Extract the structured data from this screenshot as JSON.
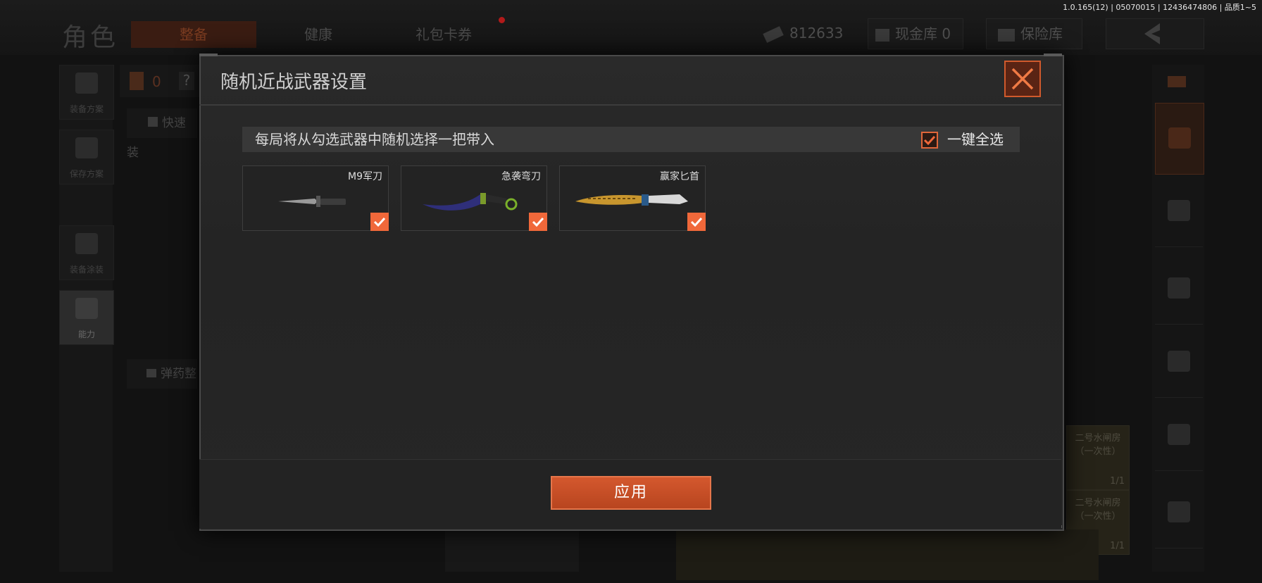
{
  "version_info": "1.0.165(12) | 05070015 | 12436474806 | 品质1~5",
  "header": {
    "title": "角色",
    "tabs": [
      {
        "label": "整备"
      },
      {
        "label": "健康"
      },
      {
        "label": "礼包卡券"
      }
    ],
    "money": "812633",
    "cash_vault": "现金库 0",
    "safe_box": "保险库"
  },
  "sidebar": {
    "items": [
      {
        "label": "装备方案"
      },
      {
        "label": "保存方案"
      },
      {
        "label": "装备涂装"
      },
      {
        "label": "能力"
      }
    ],
    "armor_count": "0",
    "help": "?",
    "quick_equip": "快速装",
    "ammo_sort": "弹药整"
  },
  "background_cells": {
    "label_a": "二号水闸房",
    "label_b": "（一次性）",
    "count": "1/1"
  },
  "dialog": {
    "title": "随机近战武器设置",
    "notice": "每局将从勾选武器中随机选择一把带入",
    "select_all_label": "一键全选",
    "select_all_checked": true,
    "weapons": [
      {
        "name": "M9军刀",
        "checked": true
      },
      {
        "name": "急袭弯刀",
        "checked": true
      },
      {
        "name": "赢家匕首",
        "checked": true
      }
    ],
    "apply_label": "应用"
  },
  "colors": {
    "accent": "#f0683a",
    "apply_button": "#c54f25",
    "close_border": "#d05a2c"
  }
}
